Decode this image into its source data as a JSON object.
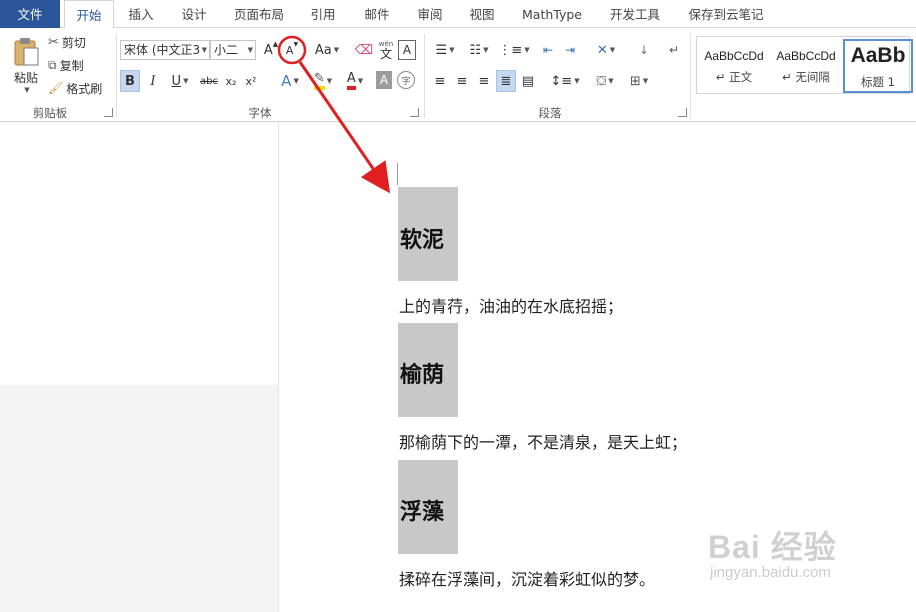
{
  "tabs": [
    "文件",
    "开始",
    "插入",
    "设计",
    "页面布局",
    "引用",
    "邮件",
    "审阅",
    "视图",
    "MathType",
    "开发工具",
    "保存到云笔记"
  ],
  "clipboard": {
    "paste": "粘贴",
    "cut": "剪切",
    "copy": "复制",
    "format_painter": "格式刷",
    "group": "剪贴板"
  },
  "font": {
    "name": "宋体 (中文正3",
    "size": "小二",
    "group": "字体",
    "bold": "B",
    "italic": "I",
    "underline": "U",
    "strike": "abc",
    "subscript": "x₂",
    "superscript": "x²",
    "grow": "A",
    "shrink": "A",
    "case": "Aa",
    "phonetic_top": "wén",
    "phonetic_bottom": "文",
    "border_char": "A",
    "color_a": "A",
    "shade_a": "A",
    "circle_char": "字"
  },
  "paragraph": {
    "group": "段落"
  },
  "styles": [
    {
      "sample": "AaBbCcDd",
      "name": "↵ 正文"
    },
    {
      "sample": "AaBbCcDd",
      "name": "↵ 无间隔"
    },
    {
      "sample": "AaBb",
      "name": "标题 1"
    }
  ],
  "document": {
    "headings": [
      "软泥",
      "榆荫",
      "浮藻"
    ],
    "lines": [
      "上的青荇，油油的在水底招摇；",
      "那榆荫下的一潭，不是清泉，是天上虹；",
      "揉碎在浮藻间，沉淀着彩虹似的梦。"
    ]
  },
  "watermark": {
    "logo": "Bai 经验",
    "url": "jingyan.baidu.com"
  },
  "colors": {
    "file_tab": "#2b579a",
    "accent": "#2b579a",
    "annotation": "#e02020",
    "heading_bg": "#c8c8c8"
  }
}
